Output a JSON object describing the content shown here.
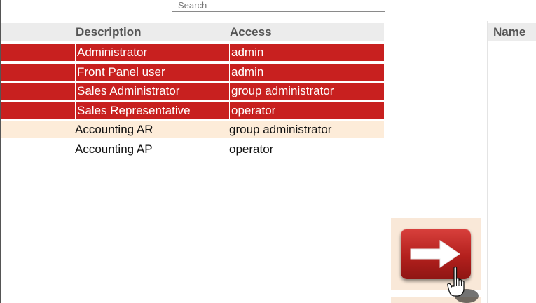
{
  "search": {
    "placeholder": "Search"
  },
  "left_table": {
    "columns": {
      "description": "Description",
      "access": "Access"
    },
    "rows": [
      {
        "description": "Administrator",
        "access": "admin",
        "state": "selected"
      },
      {
        "description": "Front Panel user",
        "access": "admin",
        "state": "selected"
      },
      {
        "description": "Sales Administrator",
        "access": "group administrator",
        "state": "selected"
      },
      {
        "description": "Sales Representative",
        "access": "operator",
        "state": "selected"
      },
      {
        "description": "Accounting AR",
        "access": "group administrator",
        "state": "hover"
      },
      {
        "description": "Accounting AP",
        "access": "operator",
        "state": "normal"
      }
    ]
  },
  "right_table": {
    "columns": {
      "name": "Name"
    }
  },
  "actions": {
    "move_right_icon": "right-arrow-icon",
    "cursor_icon": "hand-pointer-icon"
  },
  "colors": {
    "selected_row": "#c8201f",
    "hover_row": "#fdecd9",
    "header_bg": "#ececec",
    "button_red": "#b3201d"
  }
}
